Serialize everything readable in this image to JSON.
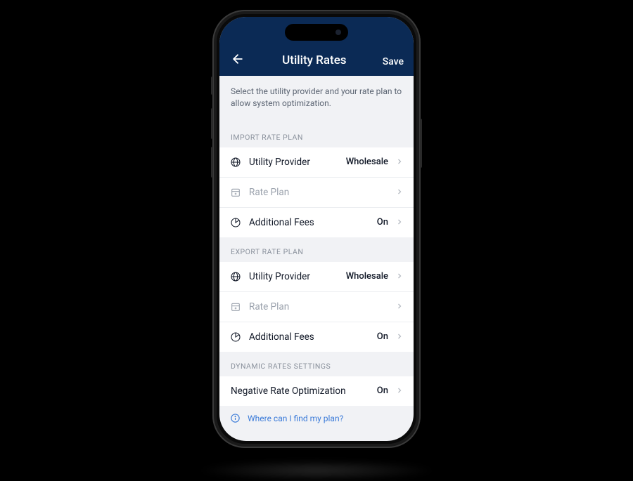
{
  "header": {
    "title": "Utility Rates",
    "save_label": "Save"
  },
  "description": "Select the utility provider and your rate plan to allow system optimization.",
  "sections": {
    "import": {
      "header": "IMPORT RATE PLAN",
      "utility_provider": {
        "label": "Utility Provider",
        "value": "Wholesale"
      },
      "rate_plan": {
        "label": "Rate Plan",
        "value": ""
      },
      "additional_fees": {
        "label": "Additional Fees",
        "value": "On"
      }
    },
    "export": {
      "header": "EXPORT RATE PLAN",
      "utility_provider": {
        "label": "Utility Provider",
        "value": "Wholesale"
      },
      "rate_plan": {
        "label": "Rate Plan",
        "value": ""
      },
      "additional_fees": {
        "label": "Additional Fees",
        "value": "On"
      }
    },
    "dynamic": {
      "header": "DYNAMIC RATES SETTINGS",
      "negative_rate": {
        "label": "Negative Rate Optimization",
        "value": "On"
      }
    }
  },
  "help": {
    "label": "Where can I find my plan?"
  }
}
